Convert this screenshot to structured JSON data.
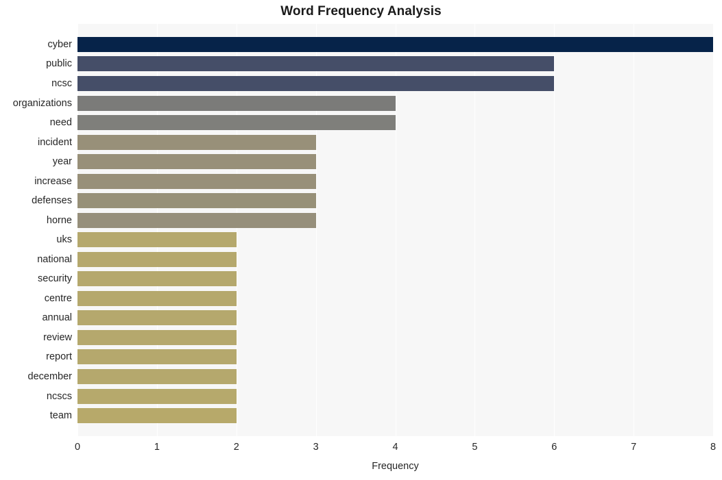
{
  "chart_data": {
    "type": "bar",
    "orientation": "horizontal",
    "title": "Word Frequency Analysis",
    "xlabel": "Frequency",
    "ylabel": "",
    "xlim": [
      0,
      8
    ],
    "xticks": [
      0,
      1,
      2,
      3,
      4,
      5,
      6,
      7,
      8
    ],
    "xtick_labels": [
      "0",
      "1",
      "2",
      "3",
      "4",
      "5",
      "6",
      "7",
      "8"
    ],
    "grid": true,
    "grid_axis": "x",
    "legend": false,
    "categories": [
      "cyber",
      "public",
      "ncsc",
      "organizations",
      "need",
      "incident",
      "year",
      "increase",
      "defenses",
      "horne",
      "uks",
      "national",
      "security",
      "centre",
      "annual",
      "review",
      "report",
      "december",
      "ncscs",
      "team"
    ],
    "values": [
      8,
      6,
      6,
      4,
      4,
      3,
      3,
      3,
      3,
      3,
      2,
      2,
      2,
      2,
      2,
      2,
      2,
      2,
      2,
      2
    ],
    "bar_colors": [
      "#062349",
      "#454e68",
      "#454e68",
      "#7b7b79",
      "#7f7f7b",
      "#989079",
      "#989079",
      "#989079",
      "#979078",
      "#968f7b",
      "#b5a86d",
      "#b5a86d",
      "#b5a86d",
      "#b5a86d",
      "#b5a86d",
      "#b5a86d",
      "#b5a86d",
      "#b5a86d",
      "#b6a96c",
      "#b7a96a"
    ],
    "plot_background": "#f7f7f7",
    "gridline_color": "#ffffff",
    "figure_background": "#ffffff"
  }
}
